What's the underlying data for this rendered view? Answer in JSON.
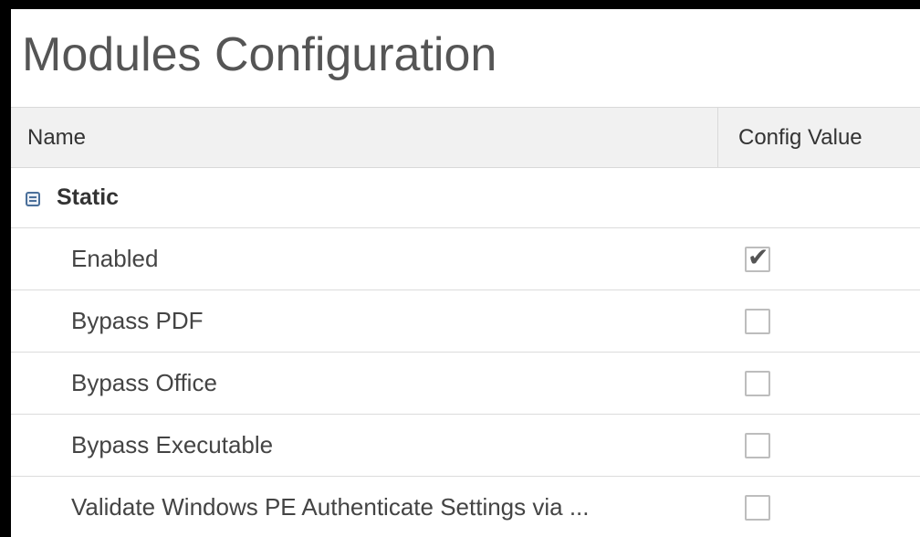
{
  "panel": {
    "title": "Modules Configuration"
  },
  "table": {
    "columns": [
      "Name",
      "Config Value"
    ],
    "group": {
      "label": "Static",
      "expanded": true,
      "toggle_icon": "minus-square-icon"
    },
    "rows": [
      {
        "name": "Enabled",
        "checked": true
      },
      {
        "name": "Bypass PDF",
        "checked": false
      },
      {
        "name": "Bypass Office",
        "checked": false
      },
      {
        "name": "Bypass Executable",
        "checked": false
      },
      {
        "name": "Validate Windows PE Authenticate Settings via ...",
        "checked": false
      }
    ]
  },
  "colors": {
    "header_bg": "#f1f1f1",
    "border": "#d9d9d9",
    "toggle_accent": "#4a6f9a",
    "frame": "#000000"
  }
}
